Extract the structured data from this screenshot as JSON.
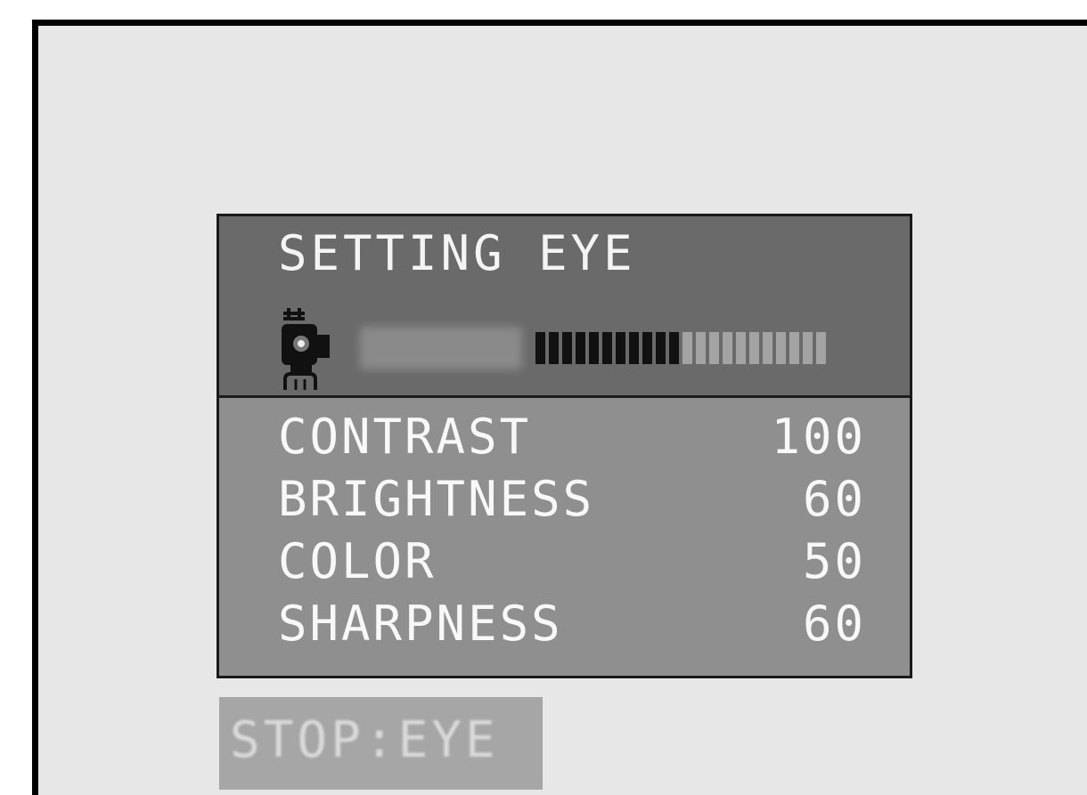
{
  "osd": {
    "title": "SETTING EYE",
    "level_fraction": 0.5,
    "items": [
      {
        "label": "CONTRAST",
        "value": "100"
      },
      {
        "label": "BRIGHTNESS",
        "value": "60"
      },
      {
        "label": "COLOR",
        "value": "50"
      },
      {
        "label": "SHARPNESS",
        "value": "60"
      }
    ]
  },
  "footer": {
    "stop_label": "STOP:EYE"
  },
  "colors": {
    "panel_top": "#6a6a6a",
    "panel_body": "#8f8f8f",
    "text": "#f4f4f4",
    "background": "#e7e7e7"
  }
}
